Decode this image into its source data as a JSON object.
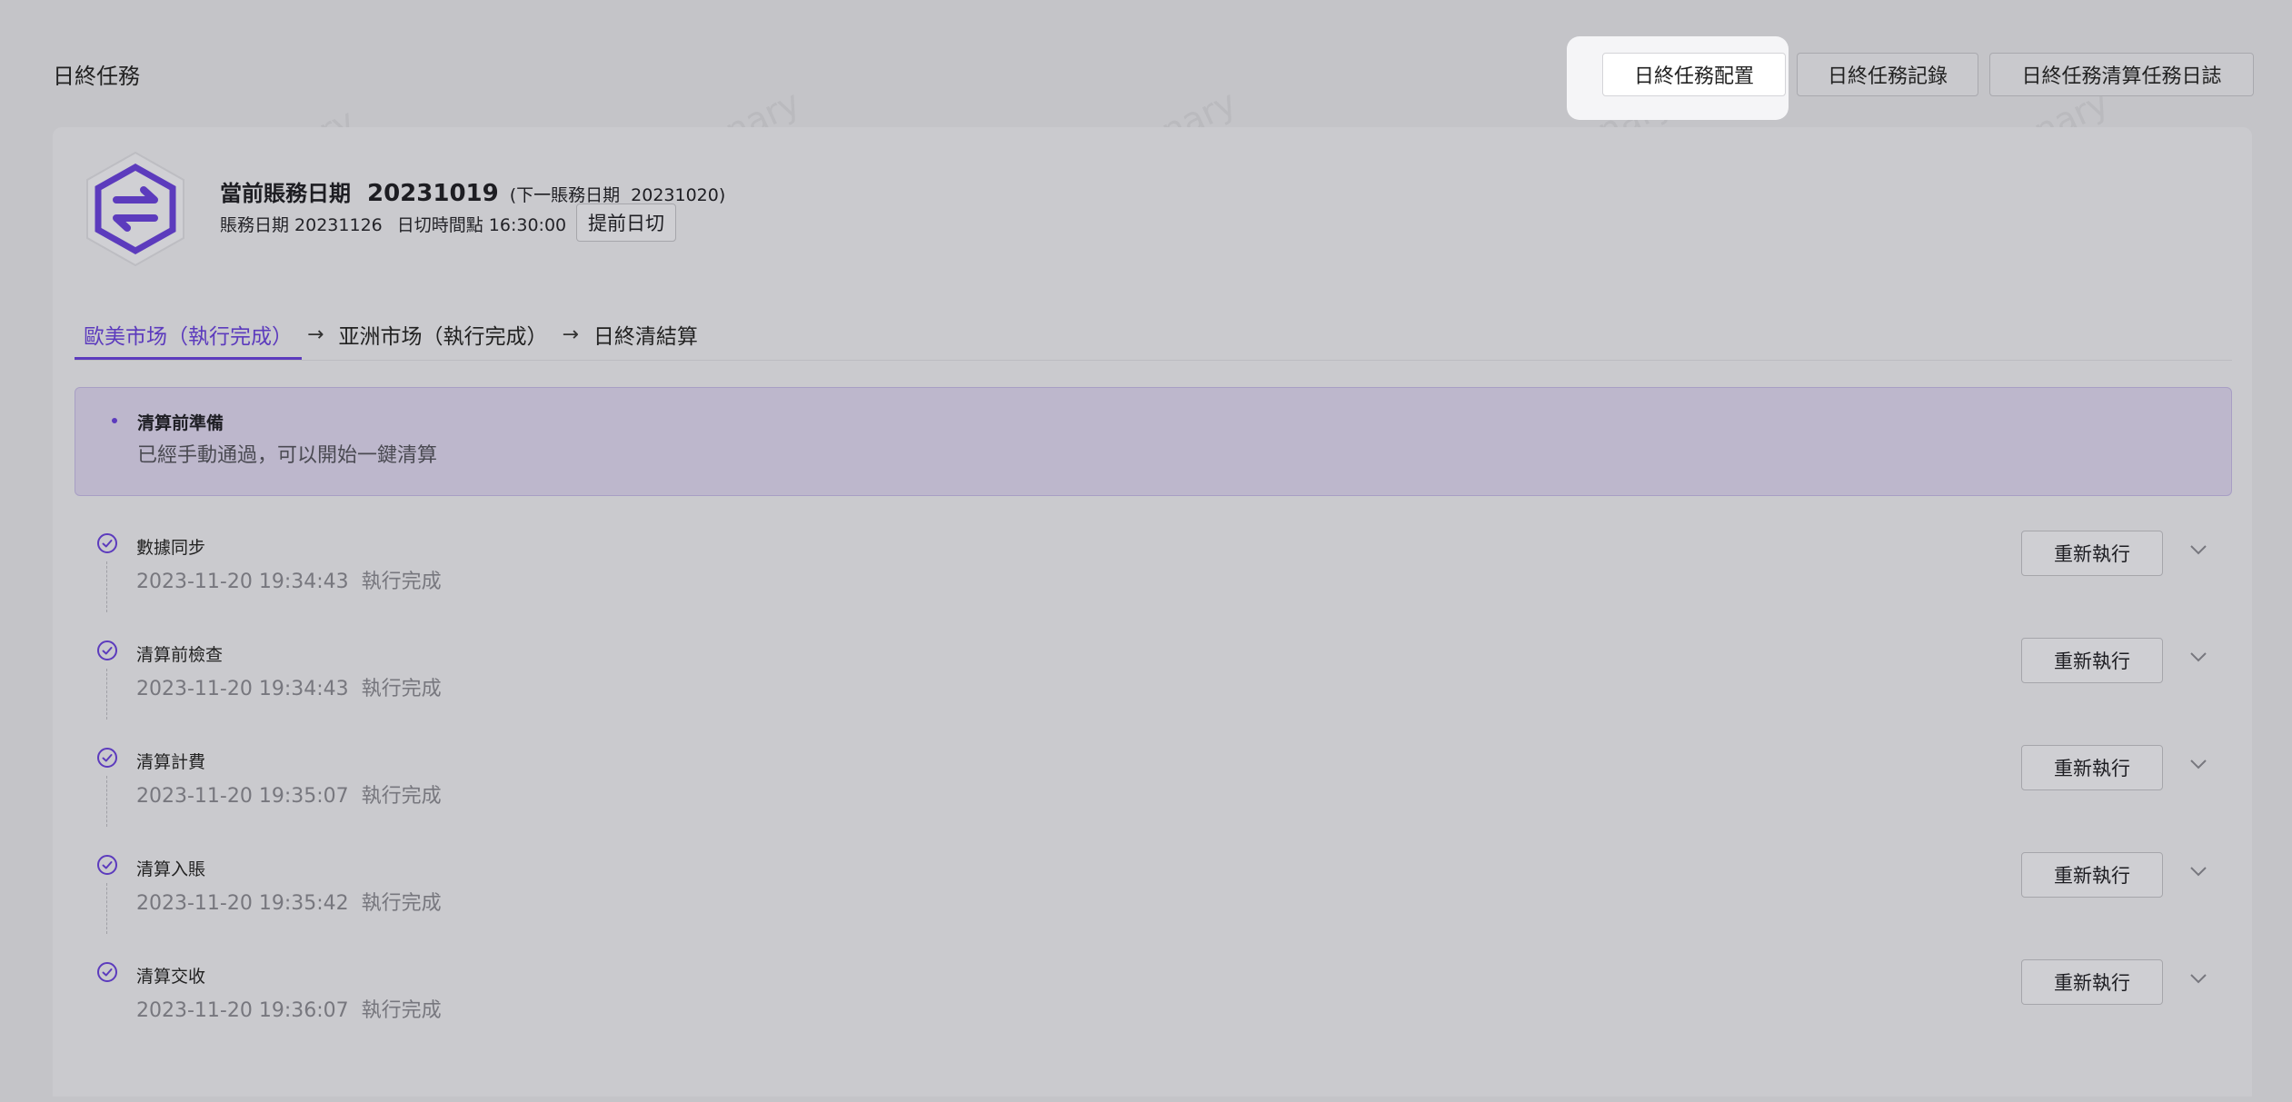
{
  "page": {
    "title": "日終任務"
  },
  "header_buttons": [
    {
      "label": "日終任務配置"
    },
    {
      "label": "日終任務記錄"
    },
    {
      "label": "日終任務清算任務日誌"
    }
  ],
  "account": {
    "title_label": "當前賬務日期",
    "current_date": "20231019",
    "next_label": "(下一賬務日期",
    "next_date": "20231020)",
    "booking_date_label": "賬務日期 20231126",
    "cutoff_label": "日切時間點 16:30:00",
    "advance_button": "提前日切"
  },
  "stepper": [
    {
      "label": "歐美市场（執行完成）"
    },
    {
      "label": "亚洲市场（執行完成）"
    },
    {
      "label": "日終清結算"
    }
  ],
  "notice": {
    "title": "清算前準備",
    "text": "已經手動通過，可以開始一鍵清算"
  },
  "tasks": [
    {
      "name": "數據同步",
      "time": "2023-11-20 19:34:43",
      "status": "執行完成",
      "action": "重新執行"
    },
    {
      "name": "清算前檢查",
      "time": "2023-11-20 19:34:43",
      "status": "執行完成",
      "action": "重新執行"
    },
    {
      "name": "清算計費",
      "time": "2023-11-20 19:35:07",
      "status": "執行完成",
      "action": "重新執行"
    },
    {
      "name": "清算入賬",
      "time": "2023-11-20 19:35:42",
      "status": "執行完成",
      "action": "重新執行"
    },
    {
      "name": "清算交收",
      "time": "2023-11-20 19:36:07",
      "status": "執行完成",
      "action": "重新執行"
    }
  ],
  "watermark": "超级管理员 canary",
  "colors": {
    "accent": "#5c3bbd",
    "overlay_bg": "#c4c4c8",
    "notice_bg": "#bdb7cc"
  }
}
